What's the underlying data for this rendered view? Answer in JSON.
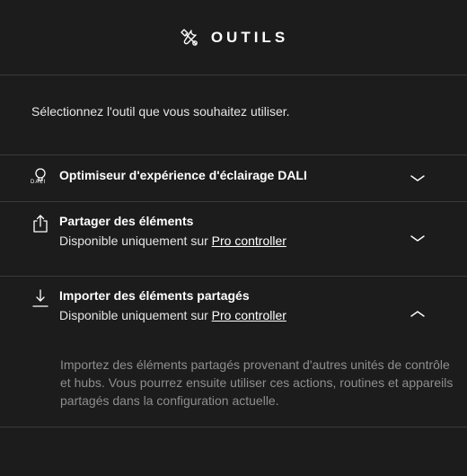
{
  "header": {
    "title": "OUTILS",
    "icon": "tools-icon"
  },
  "intro": "Sélectionnez l'outil que vous souhaitez utiliser.",
  "tools": [
    {
      "title": "Optimiseur d'expérience d'éclairage DALI",
      "icon": "dali-bulb-icon",
      "icon_label": "DALI",
      "expanded": false
    },
    {
      "title": "Partager des éléments",
      "subtitle_prefix": "Disponible uniquement sur ",
      "subtitle_link": "Pro controller",
      "icon": "share-icon",
      "expanded": false
    },
    {
      "title": "Importer des éléments partagés",
      "subtitle_prefix": "Disponible uniquement sur ",
      "subtitle_link": "Pro controller",
      "icon": "import-icon",
      "expanded": true,
      "description": "Importez des éléments partagés provenant d'autres unités de contrôle et hubs. Vous pourrez ensuite utiliser ces actions, routines et appareils partagés dans la configuration actuelle."
    }
  ],
  "colors": {
    "background": "#1c1c1c",
    "divider": "#3a3a3a",
    "text": "#ffffff",
    "muted": "#8e8e8e"
  }
}
